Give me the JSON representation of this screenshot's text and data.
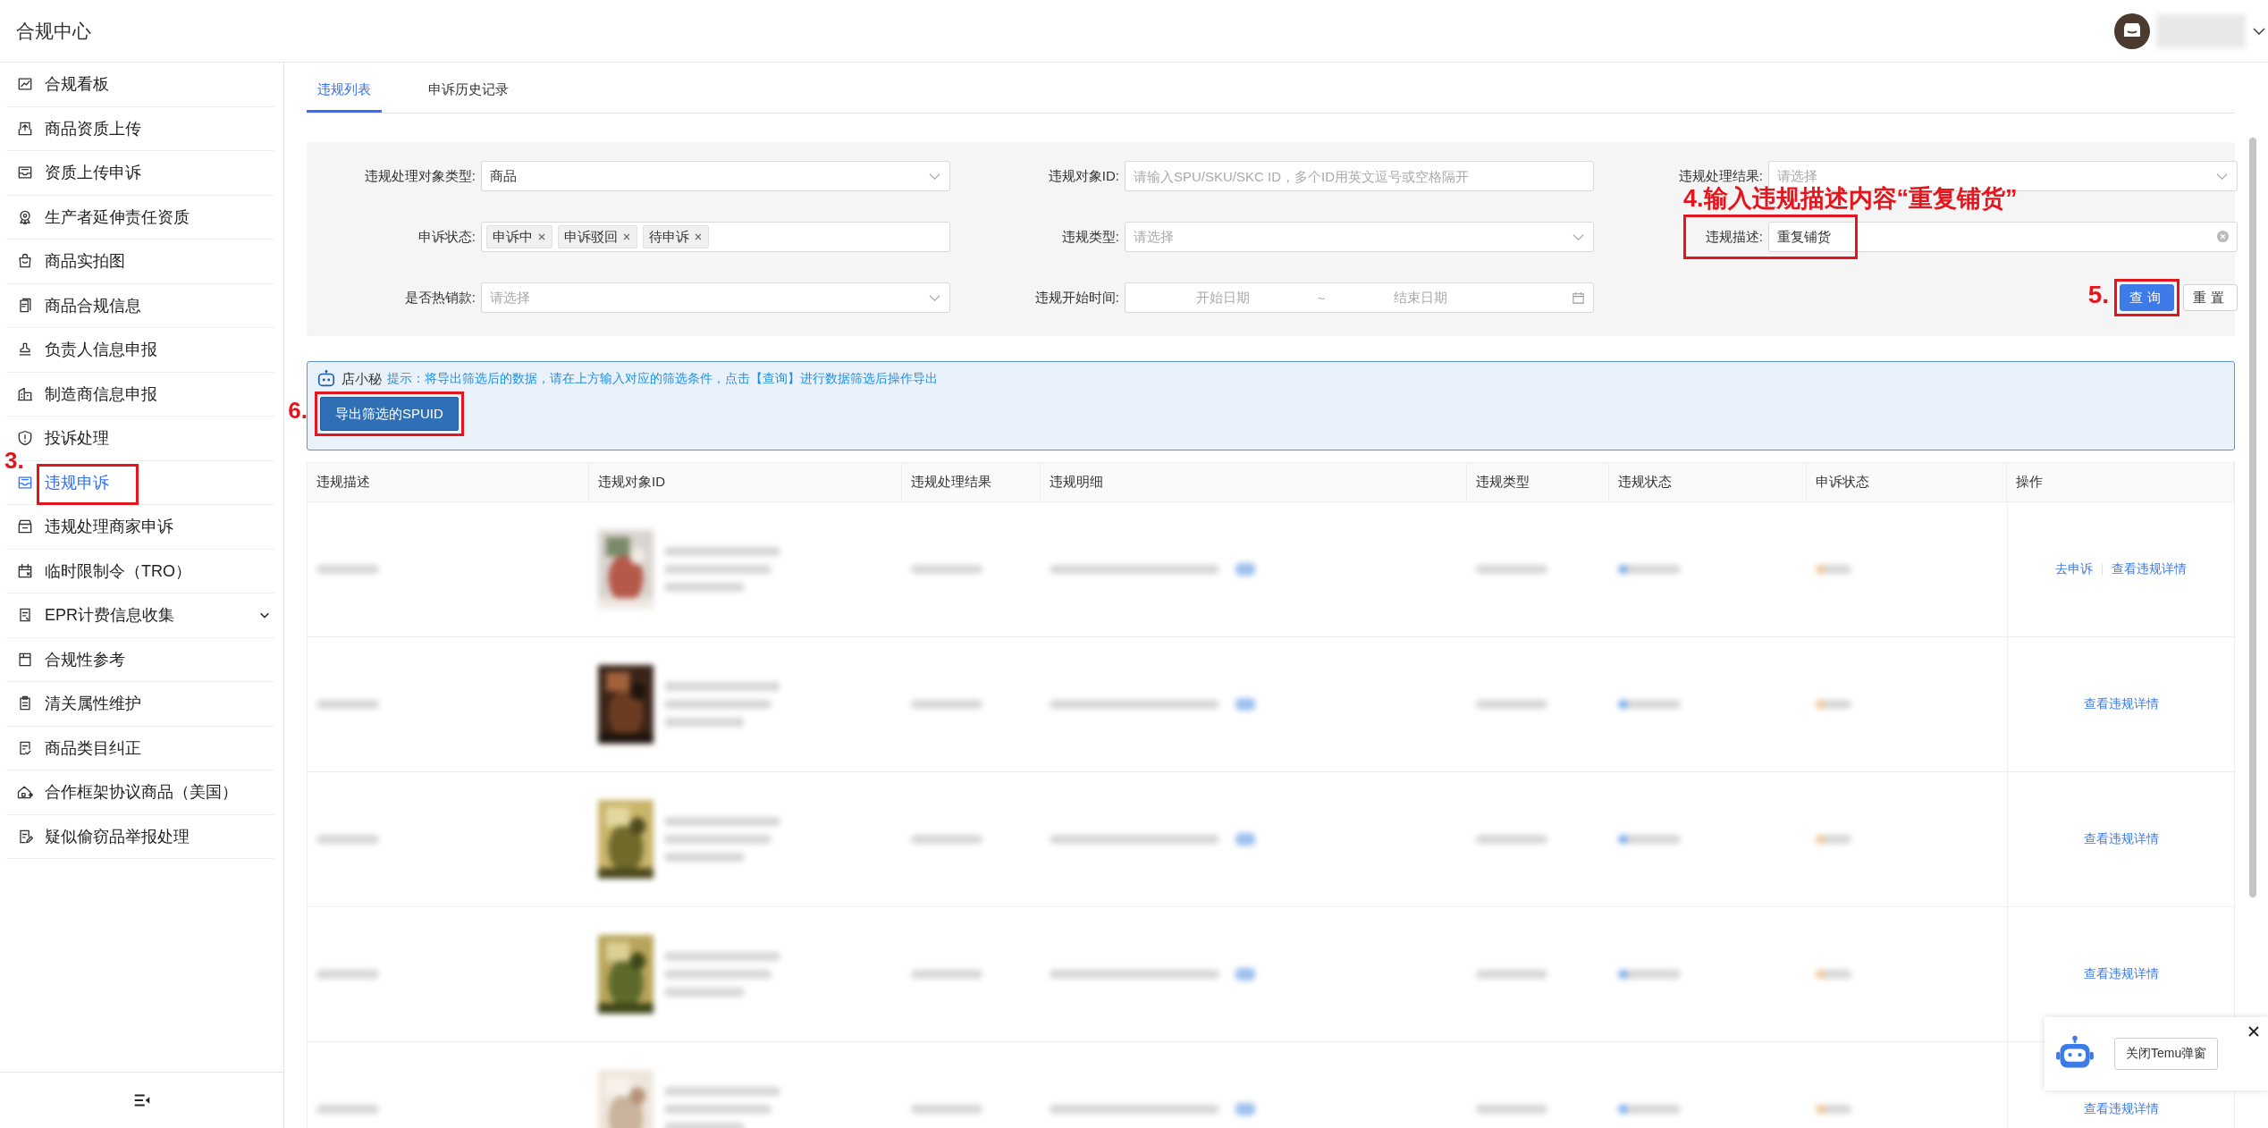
{
  "header": {
    "title": "合规中心"
  },
  "sidebar": {
    "items": [
      {
        "label": "合规看板",
        "kind": "link",
        "selected": false
      },
      {
        "label": "商品资质上传",
        "kind": "link",
        "selected": false
      },
      {
        "label": "资质上传申诉",
        "kind": "link",
        "selected": false
      },
      {
        "label": "生产者延伸责任资质",
        "kind": "link",
        "selected": false
      },
      {
        "label": "商品实拍图",
        "kind": "link",
        "selected": false
      },
      {
        "label": "商品合规信息",
        "kind": "link",
        "selected": false
      },
      {
        "label": "负责人信息申报",
        "kind": "link",
        "selected": false
      },
      {
        "label": "制造商信息申报",
        "kind": "link",
        "selected": false
      },
      {
        "label": "投诉处理",
        "kind": "link",
        "selected": false
      },
      {
        "label": "违规申诉",
        "kind": "link",
        "selected": true,
        "annotation": "3."
      },
      {
        "label": "违规处理商家申诉",
        "kind": "link",
        "selected": false
      },
      {
        "label": "临时限制令（TRO）",
        "kind": "link",
        "selected": false
      },
      {
        "label": "EPR计费信息收集",
        "kind": "group",
        "expanded": false,
        "selected": false
      },
      {
        "label": "合规性参考",
        "kind": "link",
        "selected": false
      },
      {
        "label": "清关属性维护",
        "kind": "link",
        "selected": false
      },
      {
        "label": "商品类目纠正",
        "kind": "link",
        "selected": false
      },
      {
        "label": "合作框架协议商品（美国）",
        "kind": "link",
        "selected": false
      },
      {
        "label": "疑似偷窃品举报处理",
        "kind": "link",
        "selected": false
      }
    ]
  },
  "tabs": [
    {
      "label": "违规列表",
      "selected": true
    },
    {
      "label": "申诉历史记录",
      "selected": false
    }
  ],
  "filters": [
    {
      "label": "违规处理对象类型:",
      "kind": "select",
      "value": "商品"
    },
    {
      "label": "违规对象ID:",
      "kind": "text",
      "placeholder": "请输入SPU/SKU/SKC ID，多个ID用英文逗号或空格隔开"
    },
    {
      "label": "违规处理结果:",
      "kind": "select",
      "placeholder": "请选择"
    },
    {
      "label": "申诉状态:",
      "kind": "tags",
      "tags": [
        "申诉中",
        "申诉驳回",
        "待申诉"
      ]
    },
    {
      "label": "违规类型:",
      "kind": "select",
      "placeholder": "请选择"
    },
    {
      "label": "违规描述:",
      "kind": "text",
      "value": "重复铺货",
      "annotation": "4.输入违规描述内容“重复铺货”"
    },
    {
      "label": "是否热销款:",
      "kind": "select",
      "placeholder": "请选择"
    },
    {
      "label": "违规开始时间:",
      "kind": "daterange",
      "start": "开始日期",
      "separator": "~",
      "end": "结束日期"
    }
  ],
  "filter_buttons": [
    {
      "label": "查询",
      "kind": "primary",
      "annotation": "5."
    },
    {
      "label": "重置",
      "kind": "default"
    }
  ],
  "notice": {
    "bot_name": "店小秘",
    "text": "提示：将导出筛选后的数据，请在上方输入对应的筛选条件，点击【查询】进行数据筛选后操作导出",
    "button": "导出筛选的SPUID",
    "annotation": "6."
  },
  "table": {
    "columns": [
      "违规描述",
      "违规对象ID",
      "违规处理结果",
      "违规明细",
      "违规类型",
      "违规状态",
      "申诉状态",
      "操作"
    ],
    "rows": [
      {
        "thumbnail": {
          "kind": "picture"
        },
        "actions": [
          "去申诉",
          "查看违规详情"
        ]
      },
      {
        "thumbnail": {
          "kind": "picture"
        },
        "actions": [
          "查看违规详情"
        ]
      },
      {
        "thumbnail": {
          "kind": "picture"
        },
        "actions": [
          "查看违规详情"
        ]
      },
      {
        "thumbnail": {
          "kind": "picture"
        },
        "actions": [
          "查看违规详情"
        ]
      },
      {
        "thumbnail": {
          "kind": "picture"
        },
        "actions": [
          "查看违规详情"
        ]
      }
    ]
  },
  "assistant_widget": {
    "button": "关闭Temu弹窗"
  }
}
